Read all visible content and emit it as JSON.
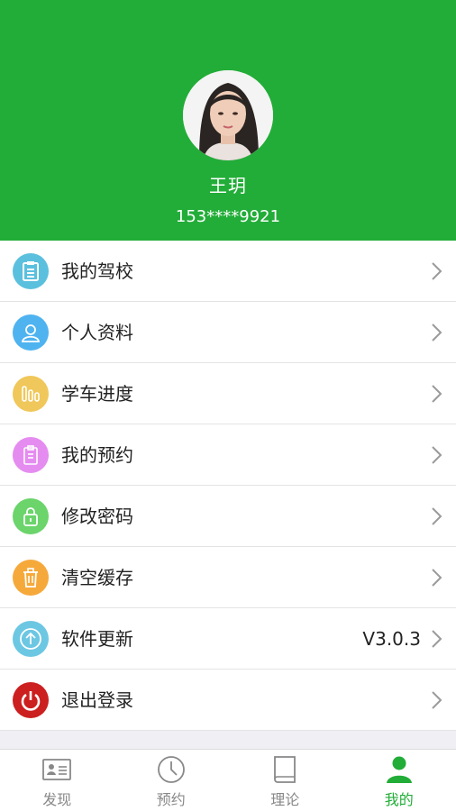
{
  "profile": {
    "name": "王玥",
    "phone": "153****9921"
  },
  "menu": [
    {
      "label": "我的驾校",
      "icon": "clipboard-icon",
      "color": "#5bc0de"
    },
    {
      "label": "个人资料",
      "icon": "person-icon",
      "color": "#4fb3f0"
    },
    {
      "label": "学车进度",
      "icon": "progress-bars-icon",
      "color": "#f0c75a"
    },
    {
      "label": "我的预约",
      "icon": "appointment-icon",
      "color": "#e58cf0"
    },
    {
      "label": "修改密码",
      "icon": "lock-icon",
      "color": "#6bd46b"
    },
    {
      "label": "清空缓存",
      "icon": "trash-icon",
      "color": "#f6a93b"
    },
    {
      "label": "软件更新",
      "icon": "upload-arrow-icon",
      "color": "#6cc7e3",
      "value": "V3.0.3"
    },
    {
      "label": "退出登录",
      "icon": "power-icon",
      "color": "#cc1f1f"
    }
  ],
  "tabs": [
    {
      "label": "发现",
      "icon": "id-card-icon",
      "active": false
    },
    {
      "label": "预约",
      "icon": "clock-icon",
      "active": false
    },
    {
      "label": "理论",
      "icon": "book-icon",
      "active": false
    },
    {
      "label": "我的",
      "icon": "user-icon",
      "active": true
    }
  ],
  "colors": {
    "brand": "#22ad38",
    "tab_inactive": "#888888"
  }
}
